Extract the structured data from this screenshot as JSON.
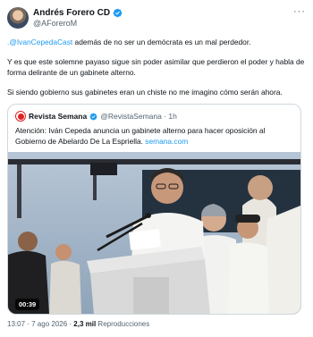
{
  "author": {
    "name": "Andrés Forero CD",
    "handle": "@AForeroM"
  },
  "tweet": {
    "p1_mention": ".@IvanCepedaCast",
    "p1_text": " además de no ser un demócrata es un mal perdedor.",
    "p2": "Y es que este solemne payaso sigue sin poder asimilar que perdieron el poder y habla de forma delirante de un gabinete alterno.",
    "p3": "Si siendo gobierno sus gabinetes eran un chiste no me imagino cómo serán ahora."
  },
  "quote": {
    "name": "Revista Semana",
    "handle": "@RevistaSemana · 1h",
    "text": "Atención: Iván Cepeda anuncia un gabinete alterno para hacer oposición al Gobierno de Abelardo De La Espriella. ",
    "link": "semana.com",
    "video_duration": "00:39"
  },
  "footer": {
    "time": "13:07 · 7 ago 2026 · ",
    "views_count": "2,3 mil",
    "views_label": " Reproducciones"
  },
  "colors": {
    "accent": "#1d9bf0",
    "text": "#0f1419",
    "muted": "#536471",
    "border": "#cfd9de"
  },
  "icons": [
    "verified-badge-icon",
    "more-options-icon"
  ]
}
